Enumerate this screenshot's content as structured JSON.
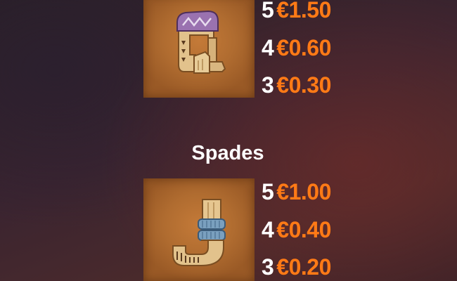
{
  "colors": {
    "count_text": "#ffffff",
    "amount_text": "#ff7a16",
    "tile_bg": "#b06c30"
  },
  "symbols": [
    {
      "name": "",
      "icon": "q-letter-icon",
      "pays": [
        {
          "count": "5",
          "amount": "€1.50"
        },
        {
          "count": "4",
          "amount": "€0.60"
        },
        {
          "count": "3",
          "amount": "€0.30"
        }
      ]
    },
    {
      "name": "Spades",
      "icon": "j-letter-icon",
      "pays": [
        {
          "count": "5",
          "amount": "€1.00"
        },
        {
          "count": "4",
          "amount": "€0.40"
        },
        {
          "count": "3",
          "amount": "€0.20"
        }
      ]
    }
  ]
}
